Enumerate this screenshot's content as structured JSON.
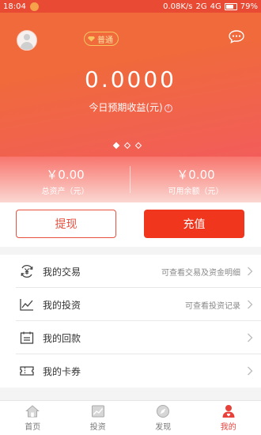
{
  "status_bar": {
    "time": "18:04",
    "network_speed": "0.08K/s",
    "signal": "2G",
    "network": "4G",
    "battery": "79%"
  },
  "hero": {
    "level_badge": "普通",
    "amount": "0.0000",
    "amount_label": "今日预期收益(元)",
    "info_symbol": "?",
    "carousel": {
      "count": 3,
      "active_index": 0
    }
  },
  "assets": {
    "total": {
      "value": "￥0.00",
      "label": "总资产（元）"
    },
    "available": {
      "value": "￥0.00",
      "label": "可用余额（元）"
    }
  },
  "actions": {
    "withdraw_label": "提现",
    "recharge_label": "充值"
  },
  "menu": [
    {
      "label": "我的交易",
      "hint": "可查看交易及资金明细",
      "icon": "yuan-cycle-icon"
    },
    {
      "label": "我的投资",
      "hint": "可查看投资记录",
      "icon": "trend-chart-icon"
    },
    {
      "label": "我的回款",
      "hint": "",
      "icon": "calendar-icon"
    },
    {
      "label": "我的卡券",
      "hint": "",
      "icon": "ticket-icon"
    }
  ],
  "tabs": [
    {
      "label": "首页",
      "icon": "home-icon",
      "active": false
    },
    {
      "label": "投资",
      "icon": "chart-icon",
      "active": false
    },
    {
      "label": "发现",
      "icon": "compass-icon",
      "active": false
    },
    {
      "label": "我的",
      "icon": "user-icon",
      "active": true
    }
  ],
  "colors": {
    "accent": "#f1361e",
    "hero_top": "#f06a3b",
    "hero_bottom": "#f25d5a",
    "active_tab": "#e8413a"
  }
}
